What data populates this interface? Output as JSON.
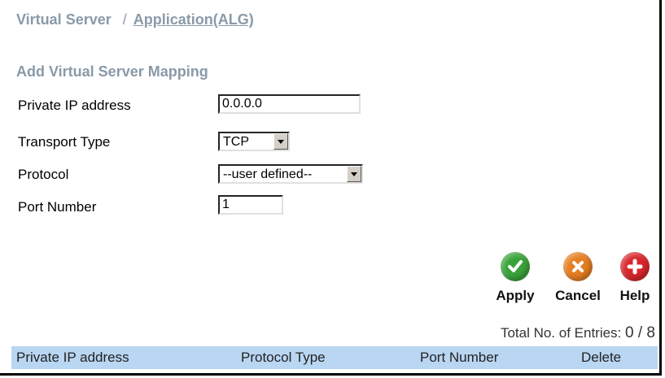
{
  "breadcrumb": {
    "current": "Virtual Server",
    "separator": "/",
    "link": "Application(ALG)"
  },
  "section_title": "Add Virtual Server Mapping",
  "form": {
    "private_ip": {
      "label": "Private IP address",
      "value": "0.0.0.0"
    },
    "transport_type": {
      "label": "Transport Type",
      "selected": "TCP"
    },
    "protocol": {
      "label": "Protocol",
      "selected": "--user defined--"
    },
    "port_number": {
      "label": "Port Number",
      "value": "1"
    }
  },
  "actions": {
    "apply": {
      "label": "Apply",
      "icon": "check-icon",
      "color": "#3aa23a"
    },
    "cancel": {
      "label": "Cancel",
      "icon": "x-icon",
      "color": "#e67e22"
    },
    "help": {
      "label": "Help",
      "icon": "plus-icon",
      "color": "#d9262b"
    }
  },
  "entries": {
    "label": "Total No. of Entries:",
    "count": "0 / 8"
  },
  "table": {
    "columns": [
      "Private IP address",
      "Protocol Type",
      "Port Number",
      "Delete"
    ]
  },
  "colors": {
    "heading": "#8a9aa8",
    "table_header_bg": "#b9d6f3"
  }
}
